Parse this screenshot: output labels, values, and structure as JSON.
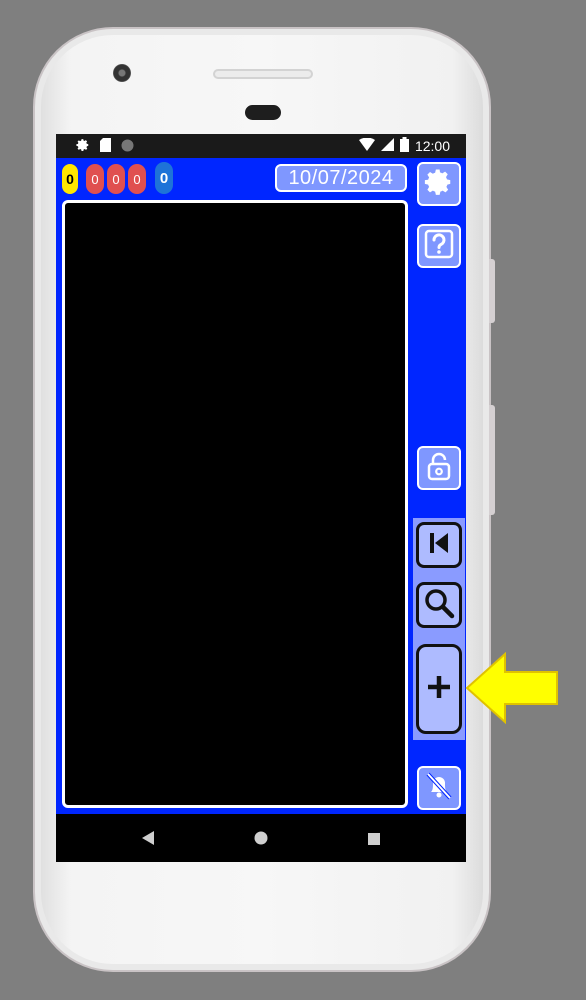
{
  "statusbar": {
    "time": "12:00"
  },
  "counters": {
    "yellow": "0",
    "red": [
      "0",
      "0",
      "0"
    ],
    "blue": "0"
  },
  "date": "10/07/2024",
  "icons": [
    "settings-icon",
    "help-icon",
    "unlock-icon",
    "skip-back-icon",
    "search-icon",
    "plus-icon",
    "bell-off-icon",
    "back-icon",
    "home-icon",
    "recents-icon",
    "arrow-icon"
  ],
  "colors": {
    "app_background": "#0026ff",
    "button": "#7f97ff",
    "panel": "#8a9bff",
    "highlight_arrow": "#ffff00"
  }
}
